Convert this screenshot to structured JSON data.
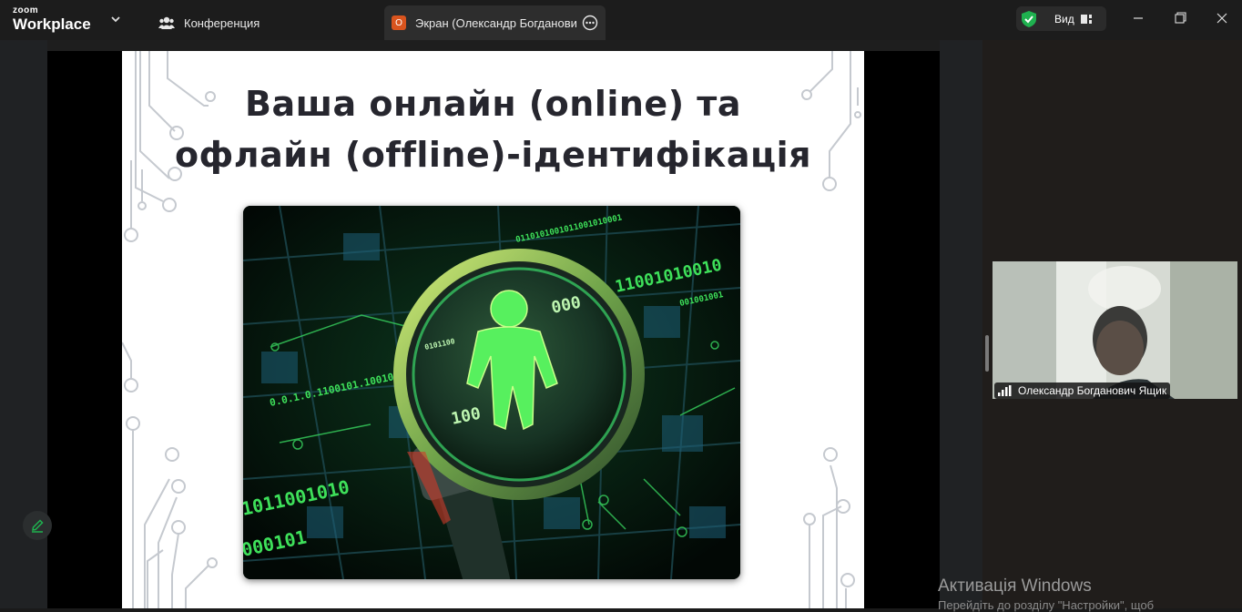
{
  "app": {
    "logo_top": "zoom",
    "logo_bottom": "Workplace"
  },
  "tabs": [
    {
      "label": "Конференция"
    },
    {
      "label": "Экран (Олександр Богданович Я",
      "badge": "O"
    }
  ],
  "view_menu": {
    "label": "Вид"
  },
  "slide": {
    "title_line1": "Ваша онлайн (online) та",
    "title_line2": "офлайн (offline)-ідентифікація"
  },
  "participant": {
    "name": "Олександр Богданович Ящик"
  },
  "watermark": {
    "title": "Активація Windows",
    "subtitle": "Перейдіть до розділу \"Настройки\", щоб"
  },
  "colors": {
    "accent_green": "#1fb14f",
    "tab_badge": "#d9541e",
    "topbar": "#1c1c1c"
  },
  "icons": [
    "chevron-down-icon",
    "participants-icon",
    "more-icon",
    "shield-icon",
    "view-icon",
    "minimize-icon",
    "maximize-icon",
    "close-icon",
    "signal-icon",
    "pencil-icon"
  ]
}
